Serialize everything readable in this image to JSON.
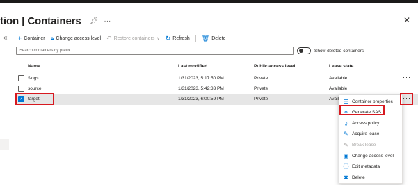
{
  "page": {
    "title": "tion | Containers",
    "pin_icon": "pin-icon",
    "more_icon": "more-icon",
    "close_icon": "close-icon"
  },
  "toolbar": {
    "container_label": "Container",
    "change_access_label": "Change access level",
    "restore_label": "Restore containers",
    "refresh_label": "Refresh",
    "delete_label": "Delete"
  },
  "search": {
    "placeholder": "Search containers by prefix",
    "value": ""
  },
  "toggle": {
    "label": "Show deleted containers",
    "on": false
  },
  "table": {
    "headers": [
      "Name",
      "Last modified",
      "Public access level",
      "Lease state"
    ],
    "rows": [
      {
        "name": "$logs",
        "modified": "1/31/2023, 5:17:50 PM",
        "access": "Private",
        "lease": "Available",
        "selected": false
      },
      {
        "name": "source",
        "modified": "1/31/2023, 5:42:33 PM",
        "access": "Private",
        "lease": "Available",
        "selected": false
      },
      {
        "name": "target",
        "modified": "1/31/2023, 6:00:59 PM",
        "access": "Private",
        "lease": "Availa",
        "selected": true
      }
    ]
  },
  "context_menu": {
    "items": [
      {
        "label": "Container properties",
        "icon": "properties-icon",
        "disabled": false
      },
      {
        "label": "Generate SAS",
        "icon": "link-icon",
        "disabled": false
      },
      {
        "label": "Access policy",
        "icon": "key-icon",
        "disabled": false
      },
      {
        "label": "Acquire lease",
        "icon": "lease-icon",
        "disabled": false
      },
      {
        "label": "Break lease",
        "icon": "break-lease-icon",
        "disabled": true
      },
      {
        "label": "Change access level",
        "icon": "lock-icon",
        "disabled": false
      },
      {
        "label": "Edit metadata",
        "icon": "info-icon",
        "disabled": false
      },
      {
        "label": "Delete",
        "icon": "trash-icon",
        "disabled": false
      }
    ]
  },
  "colors": {
    "accent": "#0078d4",
    "highlight": "#d71920",
    "selected_row": "#e6e6e6"
  }
}
